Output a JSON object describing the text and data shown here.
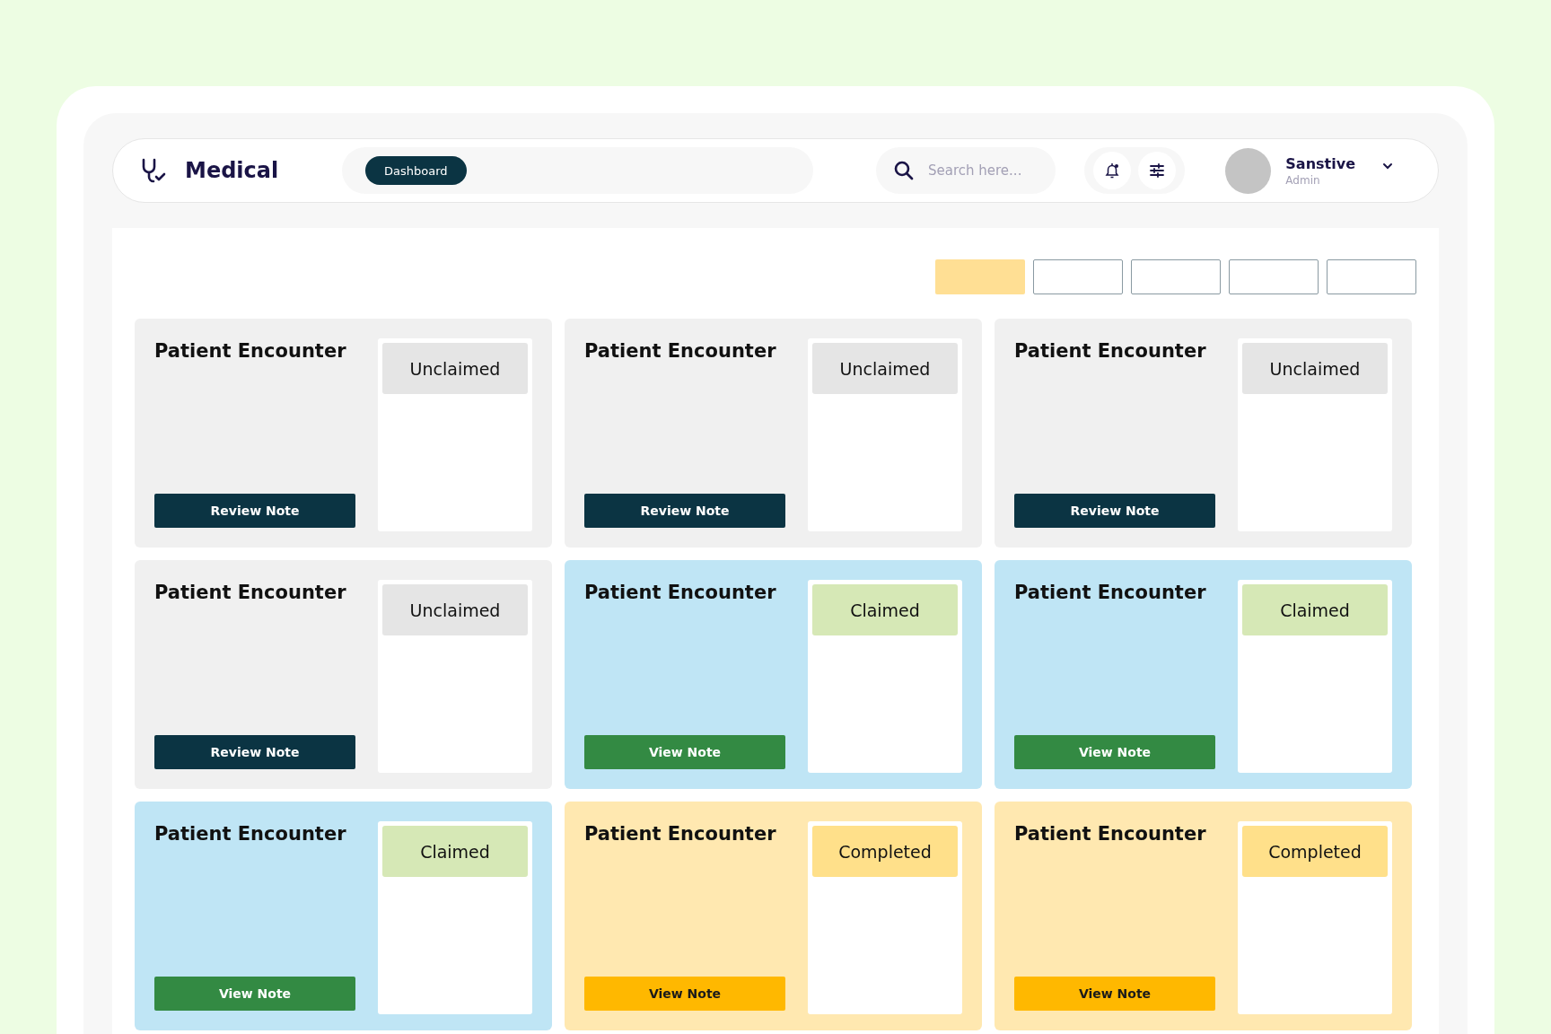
{
  "header": {
    "brand": "Medical",
    "nav": [
      {
        "label": "Dashboard",
        "selected": true
      }
    ],
    "search": {
      "placeholder": "Search here..."
    },
    "user": {
      "name": "Sanstive",
      "role": "Admin"
    }
  },
  "filters": [
    {
      "selected": true
    },
    {
      "selected": false
    },
    {
      "selected": false
    },
    {
      "selected": false
    },
    {
      "selected": false
    }
  ],
  "cards": [
    {
      "title": "Patient Encounter",
      "status": "Unclaimed",
      "kind": "unclaimed",
      "action": "Review Note"
    },
    {
      "title": "Patient Encounter",
      "status": "Unclaimed",
      "kind": "unclaimed",
      "action": "Review Note"
    },
    {
      "title": "Patient Encounter",
      "status": "Unclaimed",
      "kind": "unclaimed",
      "action": "Review Note"
    },
    {
      "title": "Patient Encounter",
      "status": "Unclaimed",
      "kind": "unclaimed",
      "action": "Review Note"
    },
    {
      "title": "Patient Encounter",
      "status": "Claimed",
      "kind": "claimed",
      "action": "View Note"
    },
    {
      "title": "Patient Encounter",
      "status": "Claimed",
      "kind": "claimed",
      "action": "View Note"
    },
    {
      "title": "Patient Encounter",
      "status": "Claimed",
      "kind": "claimed",
      "action": "View Note"
    },
    {
      "title": "Patient Encounter",
      "status": "Completed",
      "kind": "completed",
      "action": "View Note"
    },
    {
      "title": "Patient Encounter",
      "status": "Completed",
      "kind": "completed",
      "action": "View Note"
    }
  ]
}
